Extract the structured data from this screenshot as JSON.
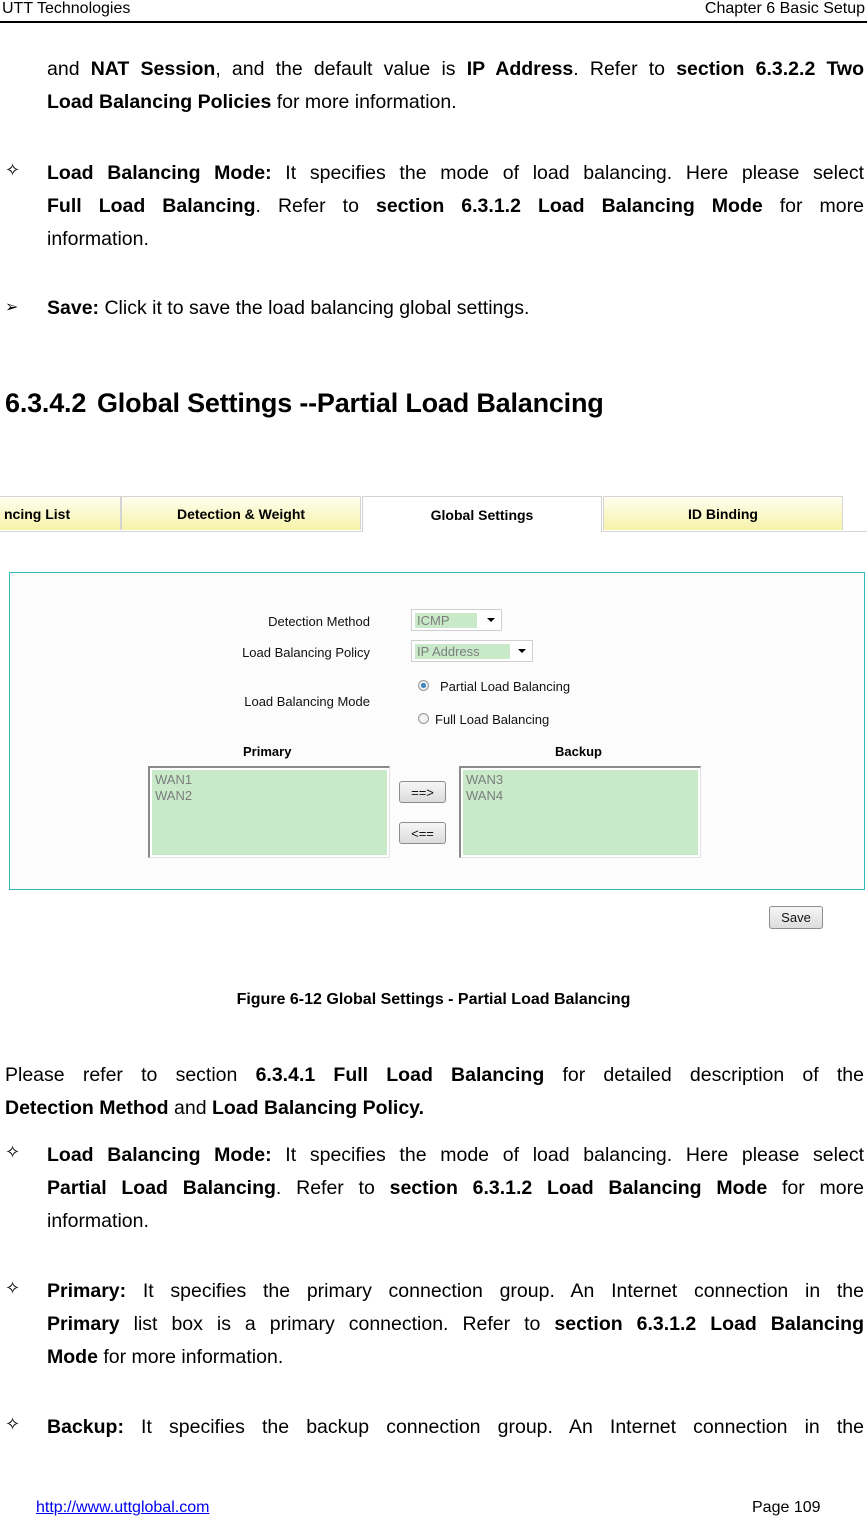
{
  "header": {
    "left": "UTT Technologies",
    "right": "Chapter 6 Basic Setup"
  },
  "intro": {
    "p1_a": "and ",
    "p1_b": "NAT Session",
    "p1_c": ", and the default value is ",
    "p1_d": "IP Address",
    "p1_e": ". Refer to ",
    "p1_f": "section 6.3.2.2 Two",
    "p2_a": "Load Balancing Policies",
    "p2_b": " for more information."
  },
  "bullets_top": [
    {
      "icon": "diamond-outline",
      "term": "Load Balancing Mode:",
      "text1": " It specifies the mode of load balancing. Here please select",
      "l2_a": "Full Load Balancing",
      "l2_b": ". Refer to ",
      "l2_c": "section 6.3.1.2 Load Balancing Mode",
      "l2_d": " for more",
      "l3": "information."
    },
    {
      "icon": "arrowhead",
      "term": "Save:",
      "text1": " Click it to save the load balancing global settings."
    }
  ],
  "section": {
    "number": "6.3.4.2",
    "title": "Global Settings --Partial Load Balancing"
  },
  "screenshot": {
    "tabs": [
      {
        "label": "ncing List",
        "active": false
      },
      {
        "label": "Detection & Weight",
        "active": false
      },
      {
        "label": "Global Settings",
        "active": true
      },
      {
        "label": "ID Binding",
        "active": false
      }
    ],
    "form": {
      "detection_method_label": "Detection Method",
      "detection_method_value": "ICMP",
      "policy_label": "Load Balancing Policy",
      "policy_value": "IP Address",
      "mode_label": "Load Balancing Mode",
      "mode_options": [
        {
          "label": "Partial Load Balancing",
          "selected": true
        },
        {
          "label": "Full Load Balancing",
          "selected": false
        }
      ],
      "primary_header": "Primary",
      "backup_header": "Backup",
      "primary_items": [
        "WAN1",
        "WAN2"
      ],
      "backup_items": [
        "WAN3",
        "WAN4"
      ],
      "move_right_label": "==>",
      "move_left_label": "<==",
      "save_label": "Save"
    },
    "colors": {
      "panel_border": "#33bcc0",
      "field_fill": "#c8eac9",
      "tab_fill": "#f7f3a8"
    }
  },
  "caption": "Figure 6-12 Global Settings - Partial Load Balancing",
  "body": {
    "p1_a": "Please refer to section ",
    "p1_b": "6.3.4.1 Full Load Balancing",
    "p1_c": " for detailed description of the",
    "p2_a": "Detection Method",
    "p2_b": " and ",
    "p2_c": "Load Balancing Policy."
  },
  "bullets_bottom": [
    {
      "term": "Load Balancing Mode:",
      "text1": " It specifies the mode of load balancing. Here please select",
      "l2_a": "Partial Load Balancing",
      "l2_b": ". Refer to ",
      "l2_c": "section 6.3.1.2 Load Balancing Mode",
      "l2_d": " for more",
      "l3": "information."
    },
    {
      "term": "Primary:",
      "text1": " It specifies the primary connection group. An Internet connection in the",
      "l2_a": "Primary",
      "l2_b": " list box is a primary connection. Refer to ",
      "l2_c": "section 6.3.1.2 Load Balancing",
      "l3_a": "Mode",
      "l3_b": " for more information."
    },
    {
      "term": "Backup:",
      "text1": " It specifies the backup connection group. An Internet connection in the"
    }
  ],
  "footer": {
    "link": "http://www.uttglobal.com",
    "page": "Page 109"
  }
}
